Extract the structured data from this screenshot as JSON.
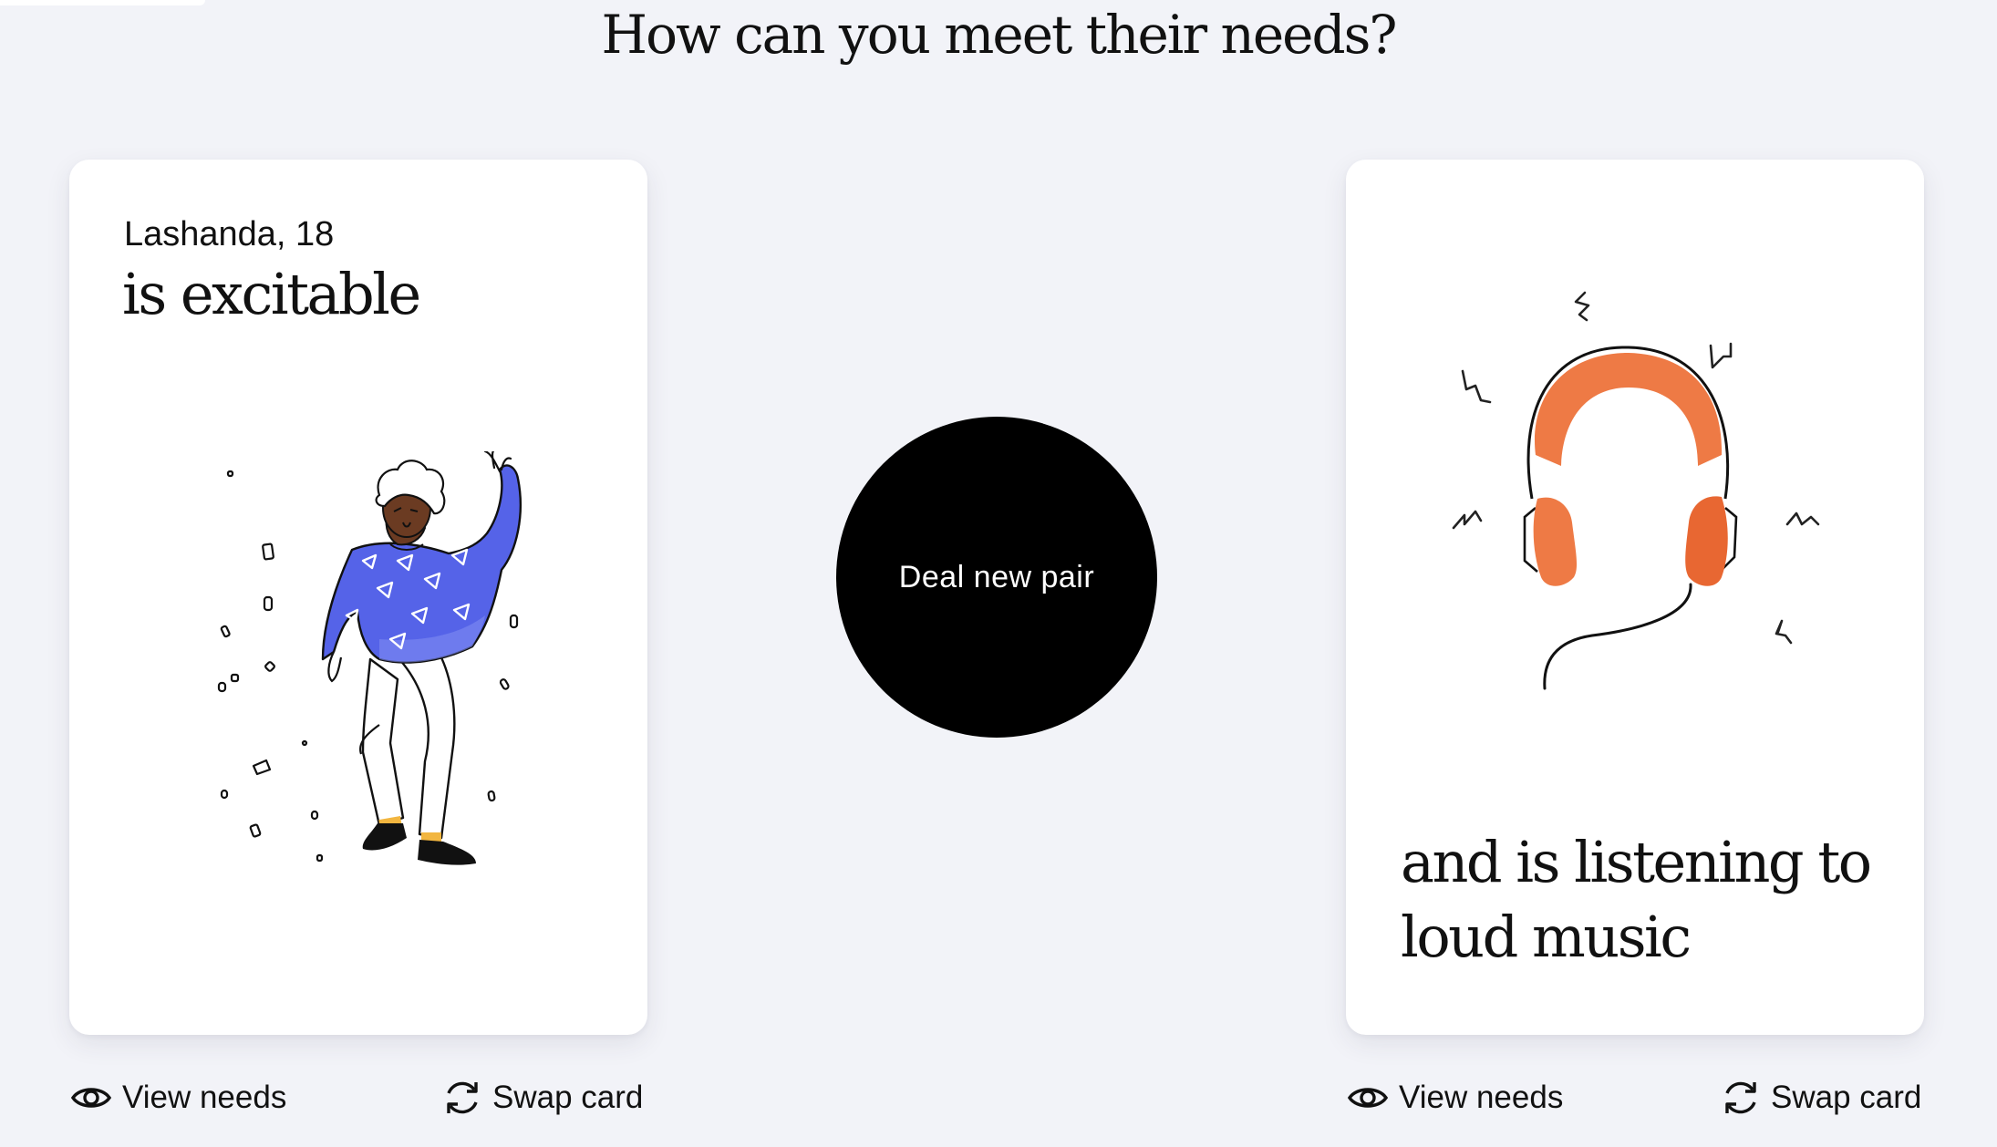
{
  "page": {
    "heading": "How can you meet their needs?"
  },
  "left_card": {
    "person": "Lashanda, 18",
    "trait": "is excitable",
    "illustration": "dancing-person",
    "sweater_color": "#5563e8"
  },
  "right_card": {
    "situation": "and is listening to loud music",
    "illustration": "headphones",
    "headphone_color": "#ee7a45"
  },
  "center": {
    "deal_label": "Deal new pair"
  },
  "actions": {
    "left_view_needs": "View needs",
    "left_swap_card": "Swap card",
    "right_view_needs": "View needs",
    "right_swap_card": "Swap card"
  },
  "icons": {
    "view": "eye-icon",
    "swap": "refresh-icon"
  },
  "colors": {
    "background": "#f2f3f8",
    "card": "#ffffff",
    "button": "#000000"
  }
}
